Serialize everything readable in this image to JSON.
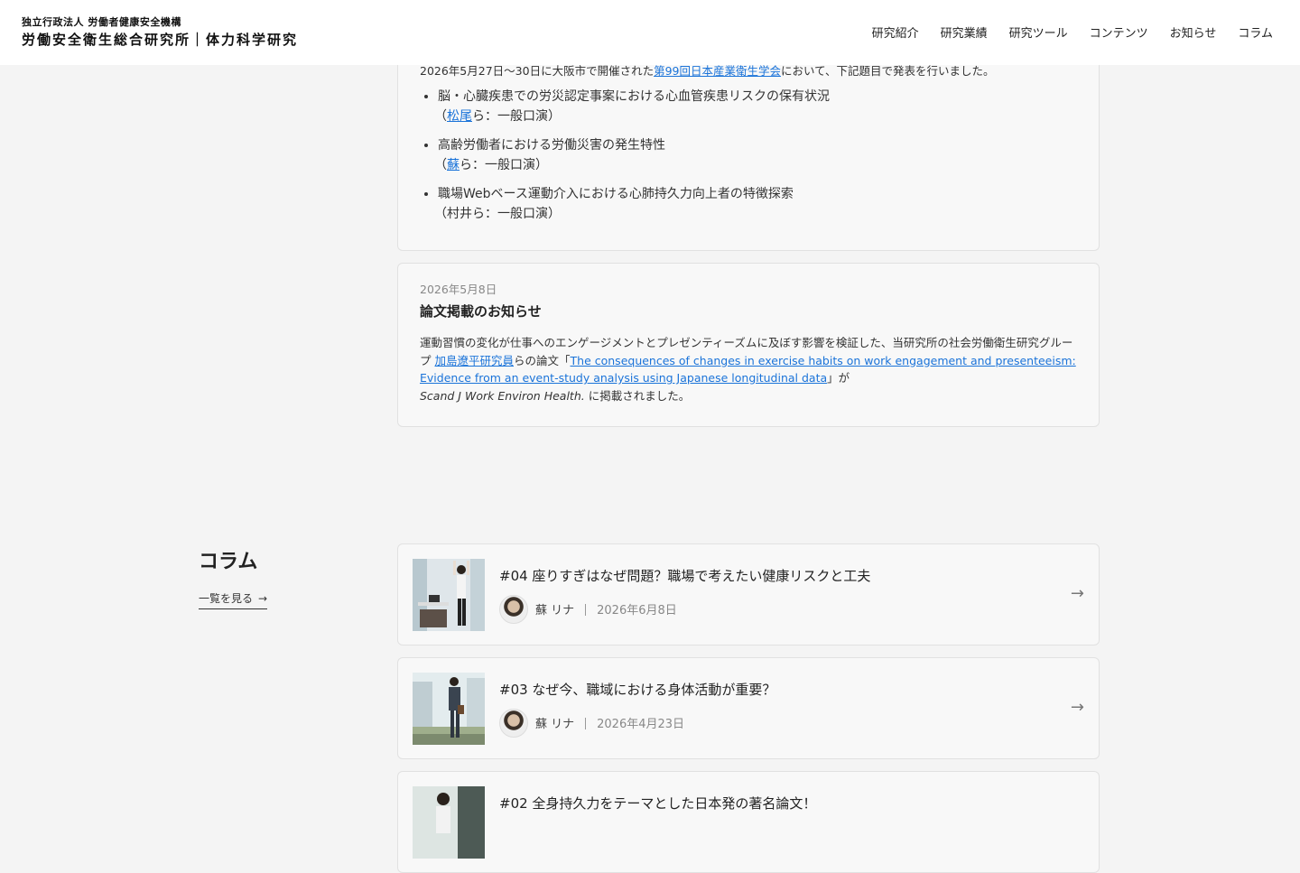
{
  "header": {
    "org_small": "独立行政法人 労働者健康安全機構",
    "org_large": "労働安全衛生総合研究所｜体力科学研究",
    "nav": [
      "研究紹介",
      "研究業績",
      "研究ツール",
      "コンテンツ",
      "お知らせ",
      "コラム"
    ]
  },
  "news1": {
    "intro_pre": "2026年5月27日〜30日に大阪市で開催された",
    "intro_link": "第99回日本産業衛生学会",
    "intro_post": "において、下記題目で発表を行いました。",
    "items": [
      {
        "title": "脳・心臓疾患での労災認定事案における心血管疾患リスクの保有状況",
        "open": "（",
        "author_link": "松尾",
        "rest": "ら：一般口演）"
      },
      {
        "title": "高齢労働者における労働災害の発生特性",
        "open": "（",
        "author_link": "蘇",
        "rest": "ら：一般口演）"
      },
      {
        "title": "職場Webベース運動介入における心肺持久力向上者の特徴探索",
        "sub": "（村井ら：一般口演）"
      }
    ]
  },
  "news2": {
    "date": "2026年5月8日",
    "title": "論文掲載のお知らせ",
    "body_pre": "運動習慣の変化が仕事へのエンゲージメントとプレゼンティーズムに及ぼす影響を検証した、当研究所の社会労働衛生研究グループ ",
    "researcher_link": "加島遼平研究員",
    "body_mid": "らの論文「",
    "paper_link": "The consequences of changes in exercise habits on work engagement and presenteeism: Evidence from an event-study analysis using Japanese longitudinal data",
    "body_mid2": "」が",
    "journal": "Scand J Work Environ Health.",
    "body_post": " に掲載されました。"
  },
  "column": {
    "heading": "コラム",
    "more": "一覧を見る",
    "more_arrow": "→",
    "items": [
      {
        "title": "#04 座りすぎはなぜ問題？職場で考えたい健康リスクと工夫",
        "author": "蘇 リナ",
        "date": "2026年6月8日"
      },
      {
        "title": "#03 なぜ今、職域における身体活動が重要？",
        "author": "蘇 リナ",
        "date": "2026年4月23日"
      },
      {
        "title": "#02 全身持久力をテーマとした日本発の著名論文！",
        "author": "",
        "date": ""
      }
    ],
    "arrow": "→"
  },
  "icons": {
    "arrow": "arrow-right-icon",
    "avatar": "author-avatar"
  }
}
